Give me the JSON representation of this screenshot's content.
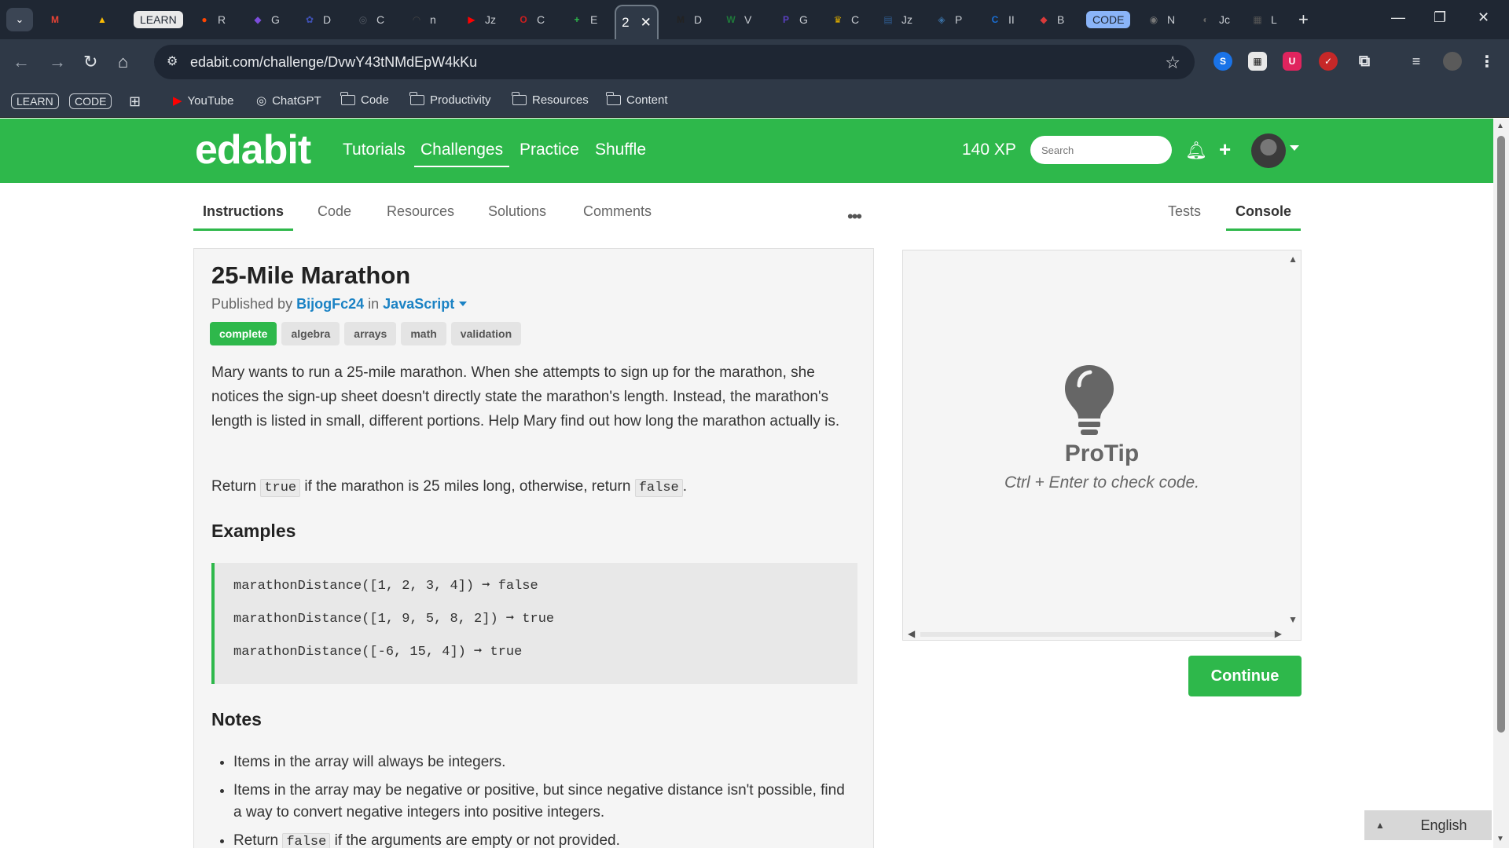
{
  "browser": {
    "tabs": [
      {
        "icon": "gmail-icon",
        "label": "",
        "color": "#ea4335",
        "glyph": "M"
      },
      {
        "icon": "google-drive-icon",
        "label": "",
        "color": "#fbbc04",
        "glyph": "▲"
      },
      {
        "icon": "learn-badge",
        "label": "LEARN",
        "color": "#e9e9e9",
        "glyph": "LEARN",
        "pill": true
      },
      {
        "icon": "reddit-icon",
        "label": "R",
        "color": "#ff4500",
        "glyph": "●"
      },
      {
        "icon": "copilot-icon",
        "label": "G",
        "color": "#7c4ddc",
        "glyph": "◆"
      },
      {
        "icon": "dev-icon",
        "label": "D",
        "color": "#3f51b5",
        "glyph": "✿"
      },
      {
        "icon": "openai-icon",
        "label": "C",
        "color": "#555c66",
        "glyph": "◎"
      },
      {
        "icon": "mask-icon",
        "label": "n",
        "color": "#444",
        "glyph": "◠"
      },
      {
        "icon": "youtube-icon",
        "label": "Jz",
        "color": "#ff0000",
        "glyph": "▶"
      },
      {
        "icon": "opera-icon",
        "label": "C",
        "color": "#cc1f1f",
        "glyph": "O"
      },
      {
        "icon": "edabit-plus-icon",
        "label": "E",
        "color": "#2eb84b",
        "glyph": "+"
      },
      {
        "icon": "medium-icon",
        "label": "D",
        "color": "#222",
        "glyph": "M"
      },
      {
        "icon": "w-icon",
        "label": "V",
        "color": "#1f7a3a",
        "glyph": "W"
      },
      {
        "icon": "p-icon",
        "label": "G",
        "color": "#5a3fc0",
        "glyph": "P"
      },
      {
        "icon": "trophy-icon",
        "label": "C",
        "color": "#d8a800",
        "glyph": "♛"
      },
      {
        "icon": "doc-icon",
        "label": "Jz",
        "color": "#2f5b8f",
        "glyph": "▤"
      },
      {
        "icon": "python-icon",
        "label": "P",
        "color": "#3a70a4",
        "glyph": "◈"
      },
      {
        "icon": "c-icon",
        "label": "II",
        "color": "#1a6fd6",
        "glyph": "C"
      },
      {
        "icon": "eraser-icon",
        "label": "B",
        "color": "#d93a3a",
        "glyph": "◆"
      },
      {
        "icon": "code-badge",
        "label": "CODE",
        "color": "#8ab4f8",
        "glyph": "CODE",
        "pill": true
      },
      {
        "icon": "chrome-icon",
        "label": "N",
        "color": "#777",
        "glyph": "◉"
      },
      {
        "icon": "globe-icon",
        "label": "Jc",
        "color": "#666",
        "glyph": "◐"
      },
      {
        "icon": "book-icon",
        "label": "L",
        "color": "#555",
        "glyph": "▦"
      }
    ],
    "active_tab_label": "2",
    "url": "edabit.com/challenge/DvwY43tNMdEpW4kKu",
    "bookmarks": {
      "learn": "LEARN",
      "code": "CODE",
      "youtube": "YouTube",
      "chatgpt": "ChatGPT",
      "code_folder": "Code",
      "productivity": "Productivity",
      "resources": "Resources",
      "content": "Content"
    }
  },
  "site": {
    "logo": "edabit",
    "nav": [
      "Tutorials",
      "Challenges",
      "Practice",
      "Shuffle"
    ],
    "active_nav": "Challenges",
    "xp": "140 XP",
    "search_placeholder": "Search",
    "brand_color": "#2eb84b"
  },
  "subtabs": {
    "left": [
      "Instructions",
      "Code",
      "Resources",
      "Solutions",
      "Comments"
    ],
    "more": "•••",
    "right": [
      "Tests",
      "Console"
    ]
  },
  "challenge": {
    "title": "25-Mile Marathon",
    "published_prefix": "Published by",
    "author": "BijogFc24",
    "in_word": "in",
    "language": "JavaScript",
    "tags": [
      "complete",
      "algebra",
      "arrays",
      "math",
      "validation"
    ],
    "description": "Mary wants to run a 25-mile marathon. When she attempts to sign up for the marathon, she notices the sign-up sheet doesn't directly state the marathon's length. Instead, the marathon's length is listed in small, different portions. Help Mary find out how long the marathon actually is.",
    "return_before": "Return ",
    "return_true": "true",
    "return_middle": " if the marathon is 25 miles long, otherwise, return ",
    "return_false": "false",
    "return_after": ".",
    "examples_heading": "Examples",
    "examples": [
      "marathonDistance([1, 2, 3, 4]) ➞ false",
      "marathonDistance([1, 9, 5, 8, 2]) ➞ true",
      "marathonDistance([-6, 15, 4]) ➞ true"
    ],
    "notes_heading": "Notes",
    "notes": [
      "Items in the array will always be integers.",
      "Items in the array may be negative or positive, but since negative distance isn't possible, find a way to convert negative integers into positive integers."
    ],
    "note3_before": "Return ",
    "note3_code": "false",
    "note3_after": " if the arguments are empty or not provided."
  },
  "console": {
    "protip_title": "ProTip",
    "protip_text": "Ctrl + Enter to check code.",
    "continue_label": "Continue"
  },
  "language_selector": "English"
}
